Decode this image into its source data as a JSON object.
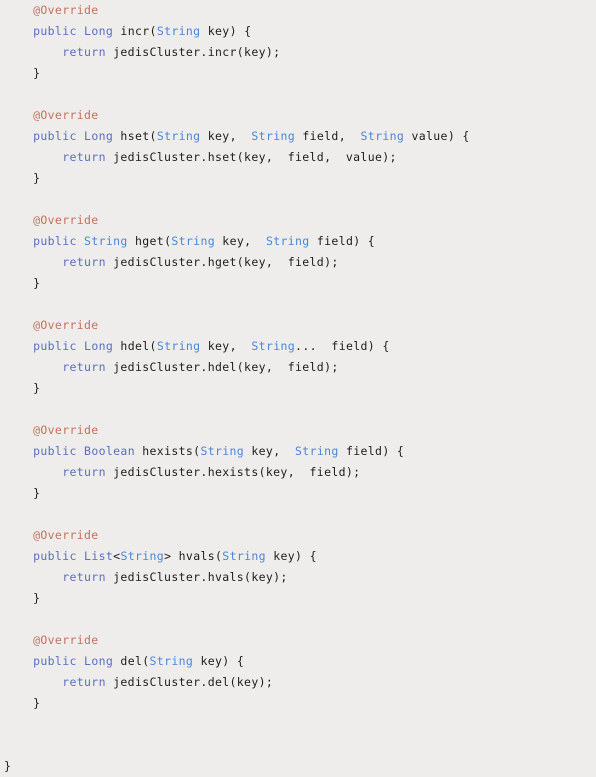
{
  "editor": {
    "language": "java",
    "background_color": "#eeedeb",
    "colors": {
      "annotation": "#c5705d",
      "keyword": "#5a6ec0",
      "type": "#4a86d8",
      "plain": "#1c1c1c"
    }
  },
  "code": {
    "indent_unit": "    ",
    "lines": [
      {
        "indent": 1,
        "tokens": [
          {
            "t": "@Override",
            "c": "annotation"
          }
        ]
      },
      {
        "indent": 1,
        "tokens": [
          {
            "t": "public",
            "c": "keyword"
          },
          {
            "t": " ",
            "c": "plain"
          },
          {
            "t": "Long",
            "c": "keyword"
          },
          {
            "t": " incr(",
            "c": "plain"
          },
          {
            "t": "String",
            "c": "type"
          },
          {
            "t": " key) {",
            "c": "plain"
          }
        ]
      },
      {
        "indent": 2,
        "tokens": [
          {
            "t": "return",
            "c": "keyword"
          },
          {
            "t": " jedisCluster.incr(key);",
            "c": "plain"
          }
        ]
      },
      {
        "indent": 1,
        "tokens": [
          {
            "t": "}",
            "c": "plain"
          }
        ]
      },
      {
        "indent": 0,
        "tokens": []
      },
      {
        "indent": 1,
        "tokens": [
          {
            "t": "@Override",
            "c": "annotation"
          }
        ]
      },
      {
        "indent": 1,
        "tokens": [
          {
            "t": "public",
            "c": "keyword"
          },
          {
            "t": " ",
            "c": "plain"
          },
          {
            "t": "Long",
            "c": "keyword"
          },
          {
            "t": " hset(",
            "c": "plain"
          },
          {
            "t": "String",
            "c": "type"
          },
          {
            "t": " key,  ",
            "c": "plain"
          },
          {
            "t": "String",
            "c": "type"
          },
          {
            "t": " field,  ",
            "c": "plain"
          },
          {
            "t": "String",
            "c": "type"
          },
          {
            "t": " value) {",
            "c": "plain"
          }
        ]
      },
      {
        "indent": 2,
        "tokens": [
          {
            "t": "return",
            "c": "keyword"
          },
          {
            "t": " jedisCluster.hset(key,  field,  value);",
            "c": "plain"
          }
        ]
      },
      {
        "indent": 1,
        "tokens": [
          {
            "t": "}",
            "c": "plain"
          }
        ]
      },
      {
        "indent": 0,
        "tokens": []
      },
      {
        "indent": 1,
        "tokens": [
          {
            "t": "@Override",
            "c": "annotation"
          }
        ]
      },
      {
        "indent": 1,
        "tokens": [
          {
            "t": "public",
            "c": "keyword"
          },
          {
            "t": " ",
            "c": "plain"
          },
          {
            "t": "String",
            "c": "type"
          },
          {
            "t": " hget(",
            "c": "plain"
          },
          {
            "t": "String",
            "c": "type"
          },
          {
            "t": " key,  ",
            "c": "plain"
          },
          {
            "t": "String",
            "c": "type"
          },
          {
            "t": " field) {",
            "c": "plain"
          }
        ]
      },
      {
        "indent": 2,
        "tokens": [
          {
            "t": "return",
            "c": "keyword"
          },
          {
            "t": " jedisCluster.hget(key,  field);",
            "c": "plain"
          }
        ]
      },
      {
        "indent": 1,
        "tokens": [
          {
            "t": "}",
            "c": "plain"
          }
        ]
      },
      {
        "indent": 0,
        "tokens": []
      },
      {
        "indent": 1,
        "tokens": [
          {
            "t": "@Override",
            "c": "annotation"
          }
        ]
      },
      {
        "indent": 1,
        "tokens": [
          {
            "t": "public",
            "c": "keyword"
          },
          {
            "t": " ",
            "c": "plain"
          },
          {
            "t": "Long",
            "c": "keyword"
          },
          {
            "t": " hdel(",
            "c": "plain"
          },
          {
            "t": "String",
            "c": "type"
          },
          {
            "t": " key,  ",
            "c": "plain"
          },
          {
            "t": "String",
            "c": "type"
          },
          {
            "t": "...  field) {",
            "c": "plain"
          }
        ]
      },
      {
        "indent": 2,
        "tokens": [
          {
            "t": "return",
            "c": "keyword"
          },
          {
            "t": " jedisCluster.hdel(key,  field);",
            "c": "plain"
          }
        ]
      },
      {
        "indent": 1,
        "tokens": [
          {
            "t": "}",
            "c": "plain"
          }
        ]
      },
      {
        "indent": 0,
        "tokens": []
      },
      {
        "indent": 1,
        "tokens": [
          {
            "t": "@Override",
            "c": "annotation"
          }
        ]
      },
      {
        "indent": 1,
        "tokens": [
          {
            "t": "public",
            "c": "keyword"
          },
          {
            "t": " ",
            "c": "plain"
          },
          {
            "t": "Boolean",
            "c": "keyword"
          },
          {
            "t": " hexists(",
            "c": "plain"
          },
          {
            "t": "String",
            "c": "type"
          },
          {
            "t": " key,  ",
            "c": "plain"
          },
          {
            "t": "String",
            "c": "type"
          },
          {
            "t": " field) {",
            "c": "plain"
          }
        ]
      },
      {
        "indent": 2,
        "tokens": [
          {
            "t": "return",
            "c": "keyword"
          },
          {
            "t": " jedisCluster.hexists(key,  field);",
            "c": "plain"
          }
        ]
      },
      {
        "indent": 1,
        "tokens": [
          {
            "t": "}",
            "c": "plain"
          }
        ]
      },
      {
        "indent": 0,
        "tokens": []
      },
      {
        "indent": 1,
        "tokens": [
          {
            "t": "@Override",
            "c": "annotation"
          }
        ]
      },
      {
        "indent": 1,
        "tokens": [
          {
            "t": "public",
            "c": "keyword"
          },
          {
            "t": " ",
            "c": "plain"
          },
          {
            "t": "List",
            "c": "keyword"
          },
          {
            "t": "<",
            "c": "plain"
          },
          {
            "t": "String",
            "c": "type"
          },
          {
            "t": "> hvals(",
            "c": "plain"
          },
          {
            "t": "String",
            "c": "type"
          },
          {
            "t": " key) {",
            "c": "plain"
          }
        ]
      },
      {
        "indent": 2,
        "tokens": [
          {
            "t": "return",
            "c": "keyword"
          },
          {
            "t": " jedisCluster.hvals(key);",
            "c": "plain"
          }
        ]
      },
      {
        "indent": 1,
        "tokens": [
          {
            "t": "}",
            "c": "plain"
          }
        ]
      },
      {
        "indent": 0,
        "tokens": []
      },
      {
        "indent": 1,
        "tokens": [
          {
            "t": "@Override",
            "c": "annotation"
          }
        ]
      },
      {
        "indent": 1,
        "tokens": [
          {
            "t": "public",
            "c": "keyword"
          },
          {
            "t": " ",
            "c": "plain"
          },
          {
            "t": "Long",
            "c": "keyword"
          },
          {
            "t": " del(",
            "c": "plain"
          },
          {
            "t": "String",
            "c": "type"
          },
          {
            "t": " key) {",
            "c": "plain"
          }
        ]
      },
      {
        "indent": 2,
        "tokens": [
          {
            "t": "return",
            "c": "keyword"
          },
          {
            "t": " jedisCluster.del(key);",
            "c": "plain"
          }
        ]
      },
      {
        "indent": 1,
        "tokens": [
          {
            "t": "}",
            "c": "plain"
          }
        ]
      },
      {
        "indent": 0,
        "tokens": []
      },
      {
        "indent": 0,
        "tokens": []
      },
      {
        "indent": 0,
        "tokens": [
          {
            "t": "}",
            "c": "plain"
          }
        ]
      }
    ]
  }
}
